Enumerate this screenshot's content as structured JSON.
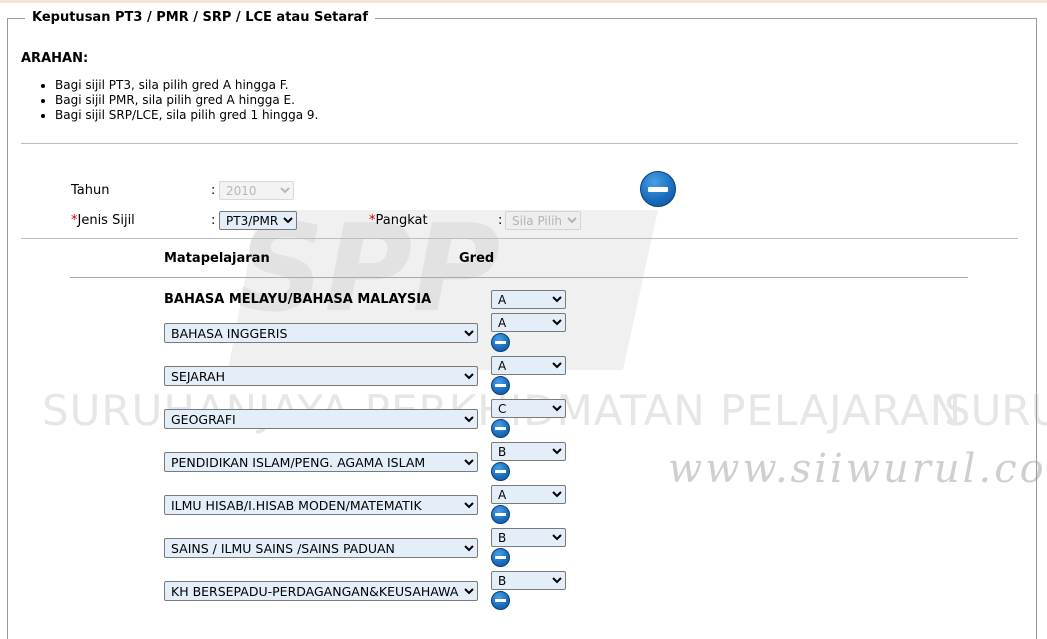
{
  "legend": "Keputusan PT3 / PMR / SRP / LCE atau Setaraf",
  "arahan": {
    "title": "ARAHAN:",
    "items": [
      "Bagi sijil PT3, sila pilih gred A hingga F.",
      "Bagi sijil PMR, sila pilih gred A hingga E.",
      "Bagi sijil SRP/LCE, sila pilih gred 1 hingga 9."
    ]
  },
  "form": {
    "tahun_label": "Tahun",
    "tahun_value": "2010",
    "jenis_label": "Jenis Sijil",
    "jenis_value": "PT3/PMR",
    "pangkat_label": "Pangkat",
    "pangkat_value": "Sila Pilih",
    "required_mark": "*",
    "colon": ":"
  },
  "table": {
    "subject_header": "Matapelajaran",
    "grade_header": "Gred",
    "fixed_subject": "BAHASA MELAYU/BAHASA MALAYSIA",
    "fixed_grade": "A",
    "rows": [
      {
        "subject": "BAHASA INGGERIS",
        "grade": "A"
      },
      {
        "subject": "SEJARAH",
        "grade": "A"
      },
      {
        "subject": "GEOGRAFI",
        "grade": "C"
      },
      {
        "subject": "PENDIDIKAN ISLAM/PENG. AGAMA ISLAM",
        "grade": "B"
      },
      {
        "subject": "ILMU HISAB/I.HISAB MODEN/MATEMATIK",
        "grade": "A"
      },
      {
        "subject": "SAINS / ILMU SAINS /SAINS PADUAN",
        "grade": "B"
      },
      {
        "subject": "KH BERSEPADU-PERDAGANGAN&KEUSAHAWAN",
        "grade": "B"
      }
    ]
  },
  "watermark": {
    "logo_text": "SPP",
    "text": "SURUHANJAYA PERKHIDMATAN PELAJARAN",
    "text_repeat": "SURU",
    "url": "www.siiwurul.com"
  },
  "colors": {
    "accent_blue": "#1a6fc0",
    "select_bg": "#e4eef9",
    "required_red": "#d00000"
  }
}
